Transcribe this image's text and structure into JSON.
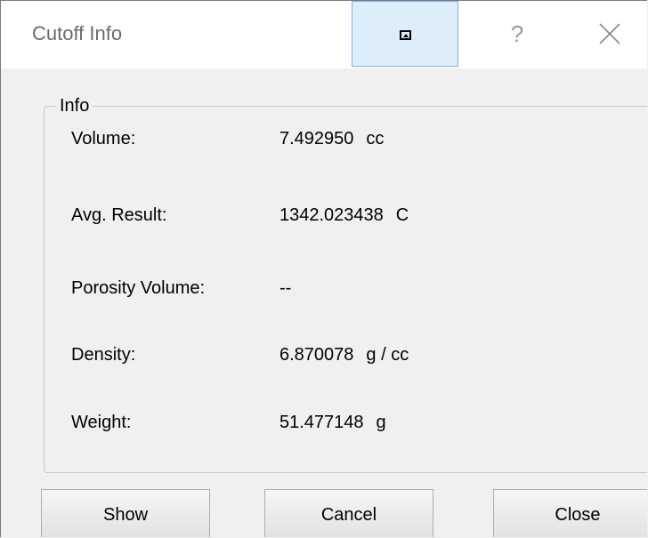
{
  "window": {
    "title": "Cutoff Info",
    "help_glyph": "?",
    "icons": {
      "restore": "restore-icon",
      "close": "close-icon"
    }
  },
  "info_group": {
    "label": "Info",
    "rows": [
      {
        "label": "Volume:",
        "value": "7.492950",
        "unit": "cc"
      },
      {
        "label": "Avg. Result:",
        "value": "1342.023438",
        "unit": "C"
      },
      {
        "label": "Porosity Volume:",
        "value": "--",
        "unit": ""
      },
      {
        "label": "Density:",
        "value": "6.870078",
        "unit": "g / cc"
      },
      {
        "label": "Weight:",
        "value": "51.477148",
        "unit": "g"
      }
    ]
  },
  "buttons": {
    "show": "Show",
    "cancel": "Cancel",
    "close": "Close"
  }
}
